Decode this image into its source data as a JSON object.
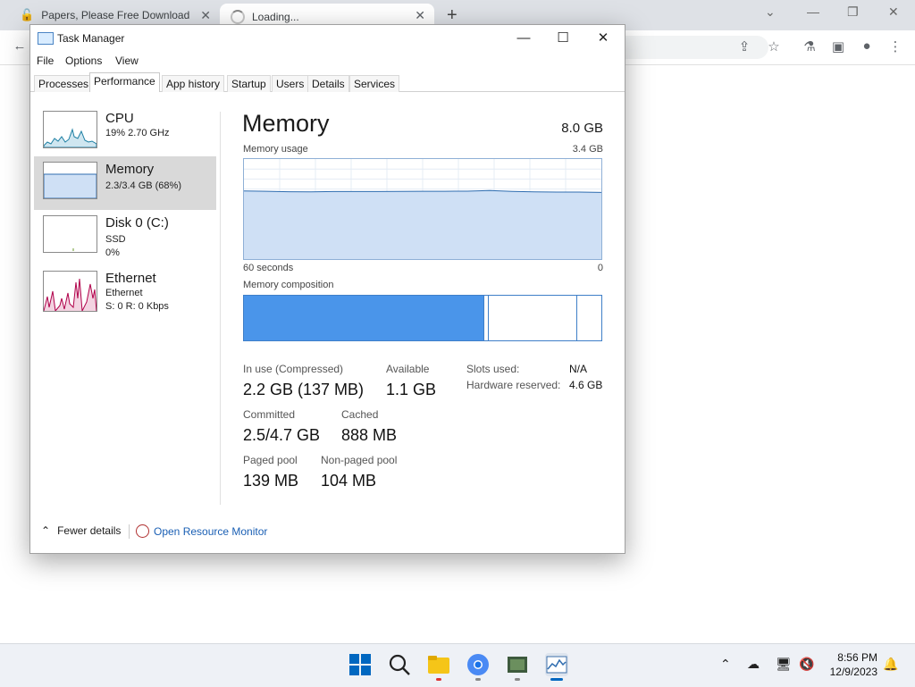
{
  "browser": {
    "tabs": [
      {
        "title": "Papers, Please Free Download (v"
      },
      {
        "title": "Loading..."
      }
    ],
    "new_tab": "+"
  },
  "taskmanager": {
    "title": "Task Manager",
    "menu": [
      "File",
      "Options",
      "View"
    ],
    "tabs": [
      "Processes",
      "Performance",
      "App history",
      "Startup",
      "Users",
      "Details",
      "Services"
    ],
    "active_tab": "Performance",
    "perf_items": [
      {
        "title": "CPU",
        "line1": "19%  2.70 GHz",
        "line2": ""
      },
      {
        "title": "Memory",
        "line1": "2.3/3.4 GB (68%)",
        "line2": ""
      },
      {
        "title": "Disk 0 (C:)",
        "line1": "SSD",
        "line2": "0%"
      },
      {
        "title": "Ethernet",
        "line1": "Ethernet",
        "line2": "S: 0  R: 0 Kbps"
      }
    ],
    "memory": {
      "title": "Memory",
      "total": "8.0 GB",
      "usage_label": "Memory usage",
      "usage_max": "3.4 GB",
      "x_left": "60 seconds",
      "x_right": "0",
      "usage_fraction": 0.68,
      "composition_label": "Memory composition",
      "composition": {
        "in_use_fraction": 0.67,
        "modified_fraction": 0.01,
        "standby_fraction": 0.25,
        "free_fraction": 0.07
      },
      "stats": {
        "in_use_label": "In use (Compressed)",
        "in_use": "2.2 GB (137 MB)",
        "available_label": "Available",
        "available": "1.1 GB",
        "committed_label": "Committed",
        "committed": "2.5/4.7 GB",
        "cached_label": "Cached",
        "cached": "888 MB",
        "paged_label": "Paged pool",
        "paged": "139 MB",
        "nonpaged_label": "Non-paged pool",
        "nonpaged": "104 MB"
      },
      "kv": [
        {
          "label": "Slots used:",
          "value": "N/A"
        },
        {
          "label": "Hardware reserved:",
          "value": "4.6 GB"
        }
      ]
    },
    "footer": {
      "fewer": "Fewer details",
      "open_rm": "Open Resource Monitor"
    }
  },
  "taskbar": {
    "time": "8:56 PM",
    "date": "12/9/2023",
    "colors": {
      "accent": "#0067c0",
      "memory_fill": "#cfe0f5",
      "memory_line": "#2f6db0",
      "composition_fill": "#4a95ea",
      "ethernet_line": "#b0004a"
    }
  }
}
